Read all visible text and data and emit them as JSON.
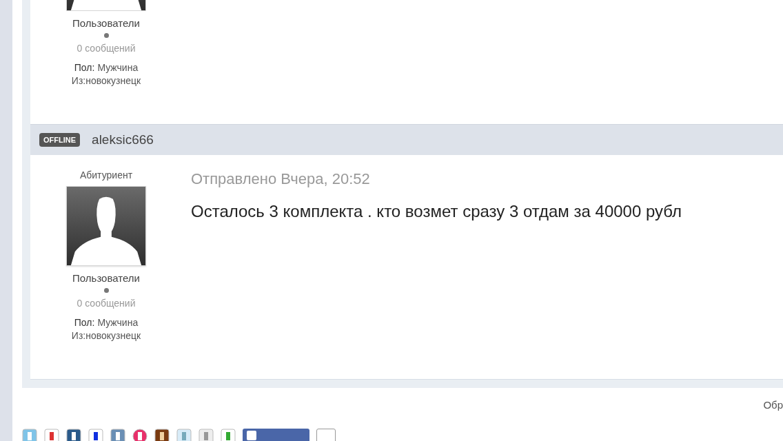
{
  "posts": [
    {
      "author": {
        "group": "Пользователи",
        "posts_count": "0 сообщений",
        "gender_label": "Пол:",
        "gender": "Мужчина",
        "location": "Из:новокузнецк"
      }
    },
    {
      "status": "OFFLINE",
      "username": "aleksic666",
      "author": {
        "rank": "Абитуриент",
        "group": "Пользователи",
        "posts_count": "0 сообщений",
        "gender_label": "Пол:",
        "gender": "Мужчина",
        "location": "Из:новокузнецк"
      },
      "posted": "Отправлено Вчера, 20:52",
      "body": "Осталось 3 комплекта . кто возмет сразу 3 отдам за 40000 рубл"
    }
  ],
  "footer_text": "Обр"
}
